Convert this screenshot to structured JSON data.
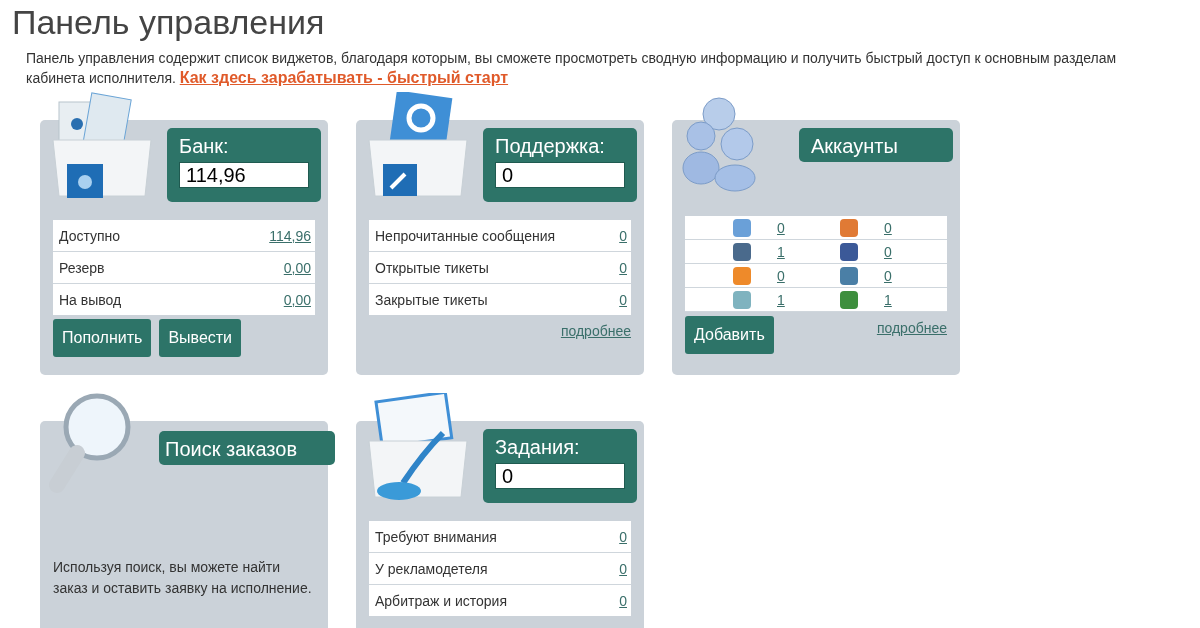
{
  "title": "Панель управления",
  "intro": {
    "text": "Панель управления содержит список виджетов, благодаря которым, вы сможете просмотреть сводную информацию и получить быстрый доступ к основным разделам кабинета исполнителя.",
    "link": "Как здесь зарабатывать - быстрый старт"
  },
  "widgets": [
    {
      "kind": "bank",
      "title": "Банк:",
      "value": "114,96",
      "rows": [
        {
          "label": "Доступно",
          "value": "114,96"
        },
        {
          "label": "Резерв",
          "value": "0,00"
        },
        {
          "label": "На вывод",
          "value": "0,00"
        }
      ],
      "buttons": [
        "Пополнить",
        "Вывести"
      ]
    },
    {
      "kind": "support",
      "title": "Поддержка:",
      "value": "0",
      "rows": [
        {
          "label": "Непрочитанные сообщения",
          "value": "0"
        },
        {
          "label": "Открытые тикеты",
          "value": "0"
        },
        {
          "label": "Закрытые тикеты",
          "value": "0"
        }
      ],
      "more_link": "подробнее"
    },
    {
      "kind": "accounts",
      "title": "Аккаунты",
      "accounts": [
        {
          "kind": "chat",
          "count": "0"
        },
        {
          "kind": "blog",
          "count": "0"
        },
        {
          "kind": "vk",
          "count": "1"
        },
        {
          "kind": "facebook",
          "count": "0"
        },
        {
          "kind": "ok",
          "count": "0"
        },
        {
          "kind": "mail",
          "count": "0"
        },
        {
          "kind": "twitter",
          "count": "1"
        },
        {
          "kind": "google",
          "count": "1"
        }
      ],
      "buttons": [
        "Добавить"
      ],
      "more_link": "подробнее"
    },
    {
      "kind": "search",
      "title": "Поиск заказов",
      "text": "Используя поиск, вы можете найти заказ и оставить заявку на исполнение."
    },
    {
      "kind": "tasks",
      "title": "Задания:",
      "value": "0",
      "rows": [
        {
          "label": "Требуют внимания",
          "value": "0"
        },
        {
          "label": "У рекламодетеля",
          "value": "0"
        },
        {
          "label": "Арбитраж и история",
          "value": "0"
        }
      ]
    }
  ]
}
